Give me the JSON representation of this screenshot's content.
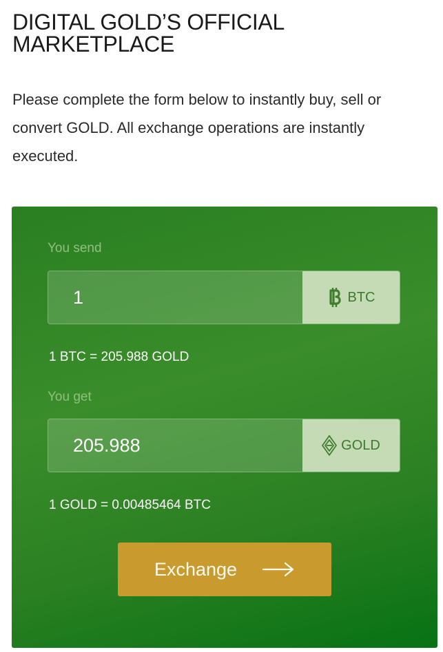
{
  "header": {
    "title_line1": "DIGITAL GOLD’S OFFICIAL",
    "title_line2": "MARKETPLACE"
  },
  "intro": {
    "text": "Please complete the form below to instantly buy, sell or convert GOLD. All exchange operations are instantly executed."
  },
  "exchange_form": {
    "send": {
      "label": "You send",
      "value": "1",
      "currency": "BTC",
      "currency_icon": "bitcoin-icon"
    },
    "send_rate": "1 BTC = 205.988 GOLD",
    "get": {
      "label": "You get",
      "value": "205.988",
      "currency": "GOLD",
      "currency_icon": "gold-diamond-icon"
    },
    "get_rate": "1 GOLD = 0.00485464 BTC",
    "button": {
      "label": "Exchange",
      "icon": "arrow-right-icon"
    }
  },
  "colors": {
    "panel_green": "#2f8425",
    "button_gold": "#c99b2e",
    "currency_bg": "#c5dbb6",
    "currency_text": "#3a7a2a"
  }
}
